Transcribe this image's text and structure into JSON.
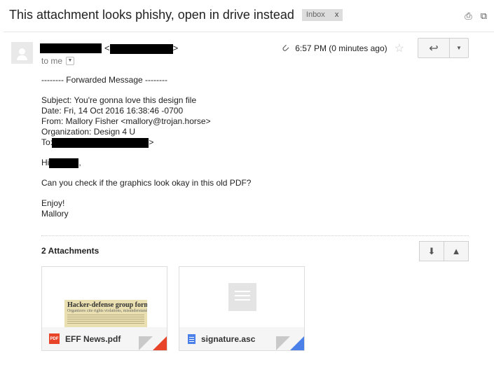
{
  "header": {
    "subject": "This attachment looks phishy, open in drive instead",
    "label": "Inbox",
    "label_remove": "x",
    "print_icon": "print-icon",
    "newwindow_icon": "new-window-icon"
  },
  "message": {
    "sender_open": "<",
    "sender_close": ">",
    "to_label": "to me",
    "time": "6:57 PM (0 minutes ago)",
    "attachment_icon": "paperclip-icon"
  },
  "body": {
    "forwarded_header": "-------- Forwarded Message --------",
    "subject_line": "Subject: You're gonna love this design file",
    "date_line": "Date: Fri, 14 Oct 2016 16:38:46 -0700",
    "from_line": "From: Mallory Fisher <mallory@trojan.horse>",
    "org_line": "Organization: Design 4 U",
    "to_prefix": "To: ",
    "to_suffix": ">",
    "greeting_prefix": "Hi",
    "greeting_suffix": ",",
    "question": "Can you check if the graphics look okay in this old PDF?",
    "signoff": "Enjoy!",
    "signature": "Mallory"
  },
  "attachments": {
    "title": "2 Attachments",
    "items": [
      {
        "name": "EFF News.pdf",
        "badge": "PDF",
        "preview_title": "Hacker-defense group forms",
        "preview_sub": "Organizers cite rights violations, misunderstanding",
        "accent": "#e8442a"
      },
      {
        "name": "signature.asc",
        "accent": "#4a80e8"
      }
    ]
  }
}
